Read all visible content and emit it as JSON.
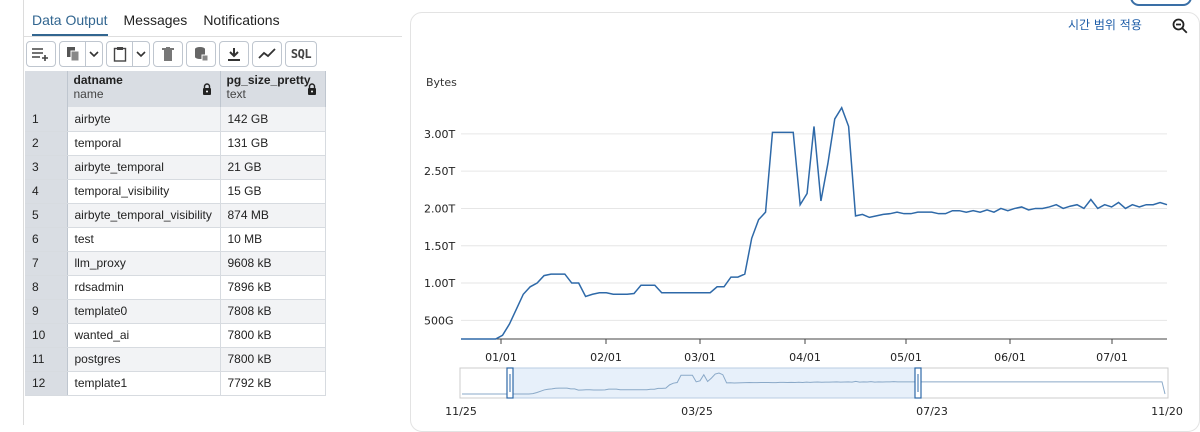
{
  "tabs": [
    {
      "label": "Data Output",
      "active": true
    },
    {
      "label": "Messages",
      "active": false
    },
    {
      "label": "Notifications",
      "active": false
    }
  ],
  "toolbar": {
    "icons": [
      "add-row-icon",
      "copy-icon",
      "paste-icon",
      "delete-icon",
      "save-data-icon",
      "download-icon",
      "graph-icon"
    ],
    "sql_label": "SQL"
  },
  "table": {
    "columns": [
      {
        "name": "datname",
        "type": "name"
      },
      {
        "name": "pg_size_pretty",
        "type": "text"
      }
    ],
    "rows": [
      {
        "n": "1",
        "datname": "airbyte",
        "size": "142 GB"
      },
      {
        "n": "2",
        "datname": "temporal",
        "size": "131 GB"
      },
      {
        "n": "3",
        "datname": "airbyte_temporal",
        "size": "21 GB"
      },
      {
        "n": "4",
        "datname": "temporal_visibility",
        "size": "15 GB"
      },
      {
        "n": "5",
        "datname": "airbyte_temporal_visibility",
        "size": "874 MB"
      },
      {
        "n": "6",
        "datname": "test",
        "size": "10 MB"
      },
      {
        "n": "7",
        "datname": "llm_proxy",
        "size": "9608 kB"
      },
      {
        "n": "8",
        "datname": "rdsadmin",
        "size": "7896 kB"
      },
      {
        "n": "9",
        "datname": "template0",
        "size": "7808 kB"
      },
      {
        "n": "10",
        "datname": "wanted_ai",
        "size": "7800 kB"
      },
      {
        "n": "11",
        "datname": "postgres",
        "size": "7800 kB"
      },
      {
        "n": "12",
        "datname": "template1",
        "size": "7792 kB"
      }
    ]
  },
  "chart_panel": {
    "time_range_label": "시간 범위 적용",
    "accent": "#2e69a8"
  },
  "chart_data": {
    "type": "line",
    "ylabel": "Bytes",
    "yticks": [
      "500G",
      "1.00T",
      "1.50T",
      "2.00T",
      "2.50T",
      "3.00T"
    ],
    "xticks": [
      "01/01",
      "02/01",
      "03/01",
      "04/01",
      "05/01",
      "06/01",
      "07/01"
    ],
    "navigator_ticks": [
      "11/25",
      "03/25",
      "07/23",
      "11/20"
    ],
    "series": [
      {
        "values_T": [
          0.25,
          0.25,
          0.25,
          0.25,
          0.25,
          0.25,
          0.3,
          0.45,
          0.65,
          0.85,
          0.95,
          1.0,
          1.1,
          1.12,
          1.12,
          1.12,
          1.0,
          1.0,
          0.82,
          0.85,
          0.87,
          0.87,
          0.85,
          0.85,
          0.85,
          0.86,
          0.97,
          0.97,
          0.97,
          0.87,
          0.87,
          0.87,
          0.87,
          0.87,
          0.87,
          0.87,
          0.87,
          0.95,
          0.95,
          1.08,
          1.08,
          1.12,
          1.6,
          1.85,
          1.95,
          3.02,
          3.02,
          3.02,
          3.02,
          2.05,
          2.2,
          3.1,
          2.1,
          2.6,
          3.2,
          3.35,
          3.1,
          1.9,
          1.92,
          1.88,
          1.9,
          1.92,
          1.93,
          1.95,
          1.93,
          1.93,
          1.95,
          1.95,
          1.95,
          1.93,
          1.93,
          1.97,
          1.97,
          1.95,
          1.97,
          1.95,
          1.98,
          1.95,
          2.0,
          1.97,
          2.0,
          2.02,
          1.98,
          2.0,
          2.0,
          2.02,
          2.05,
          2.0,
          2.03,
          2.05,
          2.0,
          2.12,
          2.0,
          2.05,
          2.02,
          2.08,
          2.0,
          2.05,
          2.02,
          2.05,
          2.05,
          2.08,
          2.05
        ]
      }
    ],
    "ylim_T": [
      0.25,
      3.5
    ],
    "grid": true
  }
}
